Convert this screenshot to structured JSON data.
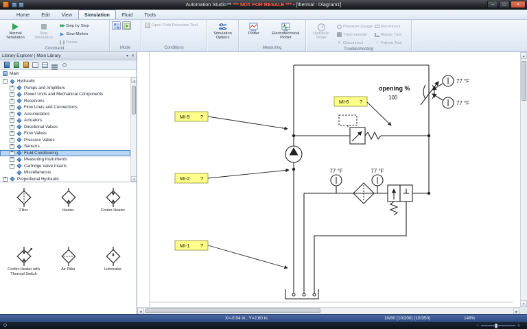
{
  "colors": {
    "accent-green": "#2ea44f",
    "label-yellow": "#ffff8a",
    "selection-blue": "#b8d6f2",
    "close-red": "#c94f3d",
    "warning-red": "#ff5b45",
    "statusbar-blue": "#31519b"
  },
  "titlebar": {
    "app_title": "Automation Studio™",
    "warning": "*** NOT FOR RESALE ***",
    "doc_title": "- [thermal : Diagram1]"
  },
  "tabs": {
    "items": [
      "Home",
      "Edit",
      "View",
      "Simulation",
      "Fluid",
      "Tools"
    ],
    "active_index": 3
  },
  "ribbon": {
    "buttons": {
      "normal_simulation": "Normal Simulation",
      "stop_simulation": "Stop Simulation",
      "step_by_step": "Step by Step",
      "slow_motion": "Slow Motion",
      "pause": "Pause",
      "open_path_detection": "Open Path Detection Tool",
      "simulation_options": "Simulation Options",
      "plotter": "Plotter",
      "electrotechnical_plotter": "Electrotechnical Plotter",
      "hydraulic_tester": "Hydraulic Tester",
      "pressure_gauge": "Pressure Gauge",
      "thermometer": "Thermometer",
      "disconnect": "Disconnect",
      "reconnect": "Reconnect",
      "repair_tool": "Repair Tool",
      "failure_tool": "Failure Tool"
    },
    "groups": {
      "command": "Command",
      "mode": "Mode",
      "conditions": "Conditions",
      "measuring": "Measuring",
      "troubleshooting": "Troubleshooting"
    }
  },
  "library": {
    "header": "Library Explorer | Main Library",
    "catalog": "Main",
    "tree": [
      {
        "label": "Hydraulic",
        "level": 0,
        "expander": "-"
      },
      {
        "label": "Pumps and Amplifiers",
        "level": 1,
        "expander": "+"
      },
      {
        "label": "Power Units and Mechanical Components",
        "level": 1,
        "expander": "+"
      },
      {
        "label": "Reservoirs",
        "level": 1,
        "expander": "+"
      },
      {
        "label": "Flow Lines and Connections",
        "level": 1,
        "expander": "+"
      },
      {
        "label": "Accumulators",
        "level": 1,
        "expander": "+"
      },
      {
        "label": "Actuators",
        "level": 1,
        "expander": "+"
      },
      {
        "label": "Directional Valves",
        "level": 1,
        "expander": "+"
      },
      {
        "label": "Flow Valves",
        "level": 1,
        "expander": "+"
      },
      {
        "label": "Pressure Valves",
        "level": 1,
        "expander": "+"
      },
      {
        "label": "Sensors",
        "level": 1,
        "expander": "+"
      },
      {
        "label": "Fluid Conditioning",
        "level": 1,
        "expander": "+",
        "selected": true
      },
      {
        "label": "Measuring Instruments",
        "level": 1,
        "expander": "+"
      },
      {
        "label": "Cartridge Valve Inserts",
        "level": 1,
        "expander": "+"
      },
      {
        "label": "Miscellaneous",
        "level": 1,
        "expander": ""
      },
      {
        "label": "Proportional Hydraulic",
        "level": 0,
        "expander": "+"
      }
    ],
    "palette": [
      {
        "label": "Filter",
        "icon": "filter"
      },
      {
        "label": "Heater",
        "icon": "heater"
      },
      {
        "label": "Cooler-Heater",
        "icon": "cooler-heater"
      },
      {
        "label": "Cooler-Heater with Thermal Switch",
        "icon": "cooler-heater-thermal-switch"
      },
      {
        "label": "Air Filter",
        "icon": "air-filter"
      },
      {
        "label": "Lubricator",
        "icon": "lubricator"
      }
    ]
  },
  "diagram": {
    "mi5": {
      "name": "MI-5",
      "value": "?"
    },
    "mi6": {
      "name": "MI-6",
      "value": "?"
    },
    "mi2": {
      "name": "MI-2",
      "value": "?"
    },
    "mi1": {
      "name": "MI-1",
      "value": "?"
    },
    "opening_label": "opening %",
    "opening_value": "100",
    "temp_gauge_top1": "77 °F",
    "temp_gauge_top2": "77 °F",
    "temp_gauge_mid1": "77 °F",
    "temp_gauge_mid2": "77 °F"
  },
  "statusbar": {
    "coordinates": "X=-0.04 in., Y=2.60 in.",
    "counters": "10/80 (10/200) (10/350)",
    "zoom": "148%"
  },
  "icons": [
    "app-icon",
    "save-icon",
    "undo-icon",
    "minimize-icon",
    "maximize-icon",
    "close-icon",
    "play-icon",
    "stop-icon",
    "step-icon",
    "slow-motion-icon",
    "pause-icon",
    "design-mode-icon",
    "simulation-mode-icon",
    "open-path-icon",
    "simulation-options-icon",
    "plotter-icon",
    "electrotechnical-plotter-icon",
    "hydraulic-tester-icon",
    "pressure-gauge-icon",
    "thermometer-icon",
    "disconnect-icon",
    "reconnect-icon",
    "repair-tool-icon",
    "failure-tool-icon",
    "collapse-icon",
    "expand-icon",
    "category-icon",
    "panel-menu-icon",
    "panel-close-icon",
    "zoom-slider"
  ]
}
